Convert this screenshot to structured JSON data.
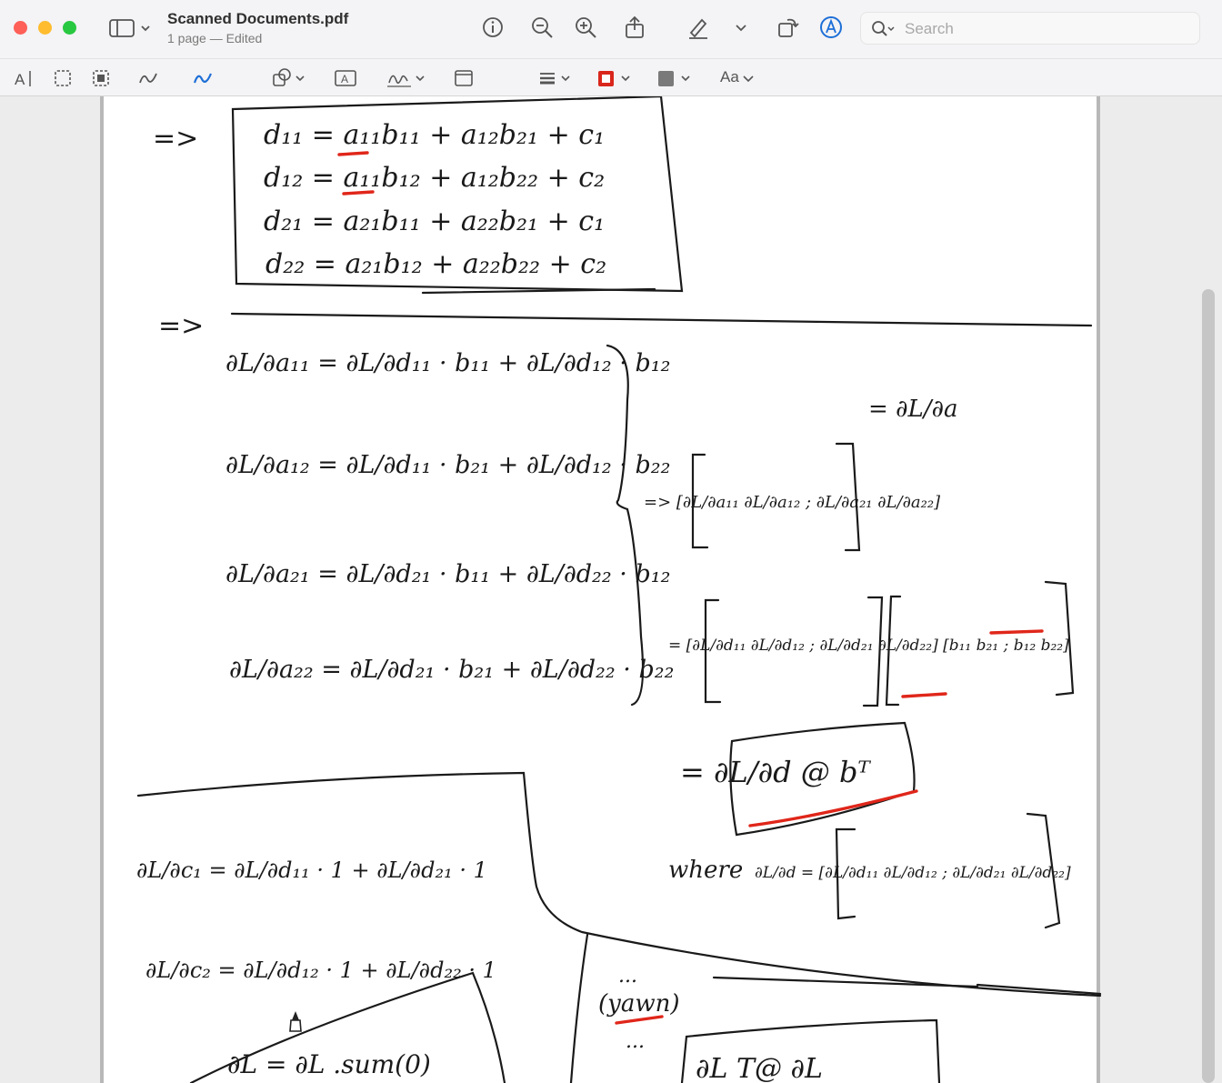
{
  "window": {
    "title": "Scanned Documents.pdf",
    "subtitle": "1 page — Edited"
  },
  "toolbar": {
    "icons": [
      "sidebar-icon",
      "info-icon",
      "zoom-out-icon",
      "zoom-in-icon",
      "share-icon",
      "highlight-icon",
      "rotate-icon",
      "markup-icon"
    ],
    "search_placeholder": "Search"
  },
  "markup_toolbar": {
    "icons": [
      "text-selection-icon",
      "rect-selection-icon",
      "smart-lasso-icon",
      "sketch-icon",
      "draw-icon",
      "shapes-icon",
      "text-box-icon",
      "sign-icon",
      "note-icon",
      "shape-style-icon",
      "border-color-icon",
      "fill-color-icon"
    ],
    "text_style_label": "Aa",
    "border_color": "#d9261c",
    "fill_color": "#7a7a7a"
  },
  "document": {
    "ink_color": "#1a1a1a",
    "highlight_color": "#e0261a",
    "lines": {
      "arrow1": "=>",
      "d11": "d₁₁ = a₁₁b₁₁ + a₁₂b₂₁ + c₁",
      "d12": "d₁₂ = a₁₁b₁₂ + a₁₂b₂₂ + c₂",
      "d21": "d₂₁ = a₂₁b₁₁ + a₂₂b₂₁ + c₁",
      "d22": "d₂₂ = a₂₁b₁₂ + a₂₂b₂₂ + c₂",
      "arrow2": "=>",
      "dLda11": "∂L/∂a₁₁ = ∂L/∂d₁₁ · b₁₁ + ∂L/∂d₁₂ · b₁₂",
      "dLda12": "∂L/∂a₁₂ = ∂L/∂d₁₁ · b₂₁ + ∂L/∂d₁₂ · b₂₂",
      "dLda21": "∂L/∂a₂₁ = ∂L/∂d₂₁ · b₁₁ + ∂L/∂d₂₂ · b₁₂",
      "dLda22": "∂L/∂a₂₂ = ∂L/∂d₂₁ · b₂₁ + ∂L/∂d₂₂ · b₂₂",
      "eq_dLda": "= ∂L/∂a",
      "matrix_lhs": "=> [∂L/∂a₁₁  ∂L/∂a₁₂ ; ∂L/∂a₂₁  ∂L/∂a₂₂]",
      "matrix_rhs": "= [∂L/∂d₁₁  ∂L/∂d₁₂ ; ∂L/∂d₂₁  ∂L/∂d₂₂] [b₁₁  b₂₁ ; b₁₂  b₂₂]",
      "result": "= ∂L/∂d @ bᵀ",
      "where_label": "where",
      "where_def": "∂L/∂d = [∂L/∂d₁₁  ∂L/∂d₁₂ ; ∂L/∂d₂₁  ∂L/∂d₂₂]",
      "dLdc1": "∂L/∂c₁ = ∂L/∂d₁₁ · 1 + ∂L/∂d₂₁ · 1",
      "dLdc2": "∂L/∂c₂ = ∂L/∂d₁₂ · 1 + ∂L/∂d₂₂ · 1",
      "sum_expr": "∂L = ∂L .sum(0)",
      "yawn": "(yawn)",
      "dots": "...",
      "bottom_box": "∂L  T@  ∂L"
    }
  }
}
